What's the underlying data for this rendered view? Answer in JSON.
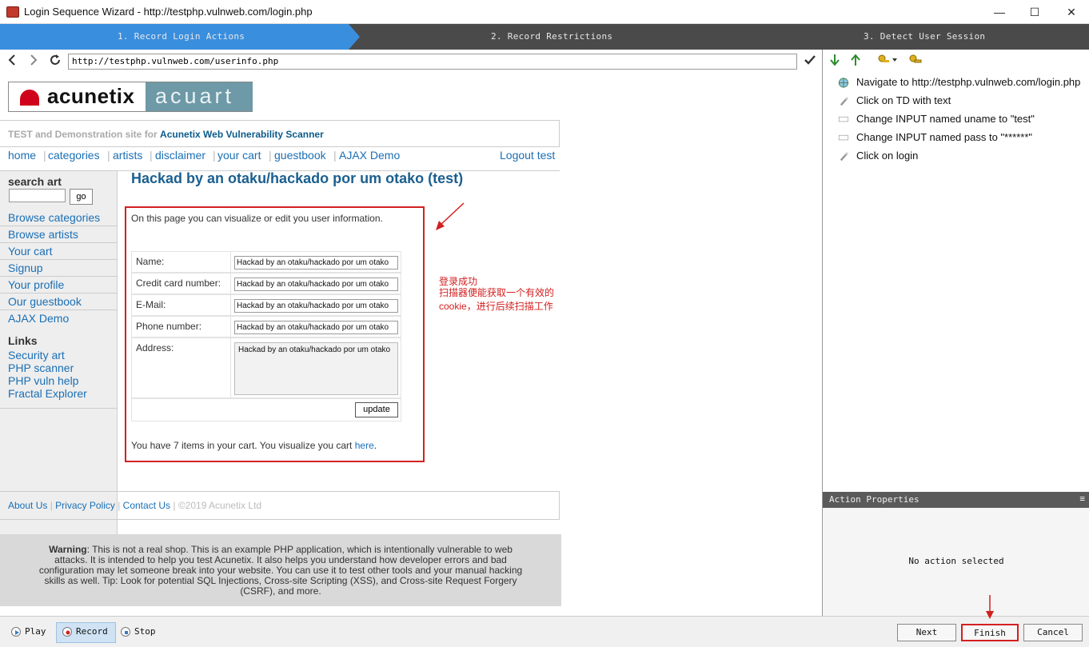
{
  "window": {
    "title": "Login Sequence Wizard - http://testphp.vulnweb.com/login.php",
    "controls": {
      "minimize": "—",
      "maximize": "☐",
      "close": "✕"
    }
  },
  "steps": [
    {
      "label": "1. Record Login Actions",
      "active": true
    },
    {
      "label": "2. Record Restrictions",
      "active": false
    },
    {
      "label": "3. Detect User Session",
      "active": false
    }
  ],
  "browser": {
    "url": "http://testphp.vulnweb.com/userinfo.php",
    "back_icon": "chevron-left-icon",
    "forward_icon": "chevron-right-icon",
    "refresh_icon": "refresh-icon",
    "go_icon": "checkmark-icon"
  },
  "site": {
    "logo_left": "acunetix",
    "logo_right": "acuart",
    "tagline_prefix": "TEST and Demonstration site for",
    "tagline_link": "Acunetix Web Vulnerability Scanner",
    "topnav": [
      "home",
      "categories",
      "artists",
      "disclaimer",
      "your cart",
      "guestbook",
      "AJAX Demo"
    ],
    "logout": "Logout test",
    "search_label": "search art",
    "search_go": "go",
    "sidebar_links": [
      "Browse categories",
      "Browse artists",
      "Your cart",
      "Signup",
      "Your profile",
      "Our guestbook",
      "AJAX Demo"
    ],
    "links_heading": "Links",
    "extra_links": [
      "Security art",
      "PHP scanner",
      "PHP vuln help",
      "Fractal Explorer"
    ],
    "page_title": "Hackad by an otaku/hackado por um otako (test)",
    "intro": "On this page you can visualize or edit you user information.",
    "form": {
      "name_label": "Name:",
      "name_value": "Hackad by an otaku/hackado por um otako",
      "cc_label": "Credit card number:",
      "cc_value": "Hackad by an otaku/hackado por um otako",
      "email_label": "E-Mail:",
      "email_value": "Hackad by an otaku/hackado por um otako",
      "phone_label": "Phone number:",
      "phone_value": "Hackad by an otaku/hackado por um otako",
      "address_label": "Address:",
      "address_value": "Hackad by an otaku/hackado por um otako",
      "update_label": "update"
    },
    "cart_text": "You have 7 items in your cart. You visualize you cart",
    "cart_link": "here",
    "cart_end": ".",
    "footer": {
      "about": "About Us",
      "privacy": "Privacy Policy",
      "contact": "Contact Us",
      "copyright": "©2019 Acunetix Ltd"
    },
    "warning_bold": "Warning",
    "warning_text": ": This is not a real shop. This is an example PHP application, which is intentionally vulnerable to web attacks. It is intended to help you test Acunetix. It also helps you understand how developer errors and bad configuration may let someone break into your website. You can use it to test other tools and your manual hacking skills as well. Tip: Look for potential SQL Injections, Cross-site Scripting (XSS), and Cross-site Request Forgery (CSRF), and more."
  },
  "annotation": {
    "line1": "登录成功",
    "line2": "扫描器便能获取一个有效的cookie，进行后续扫描工作",
    "color": "#d32020"
  },
  "actions": [
    {
      "icon": "globe-icon",
      "label": "Navigate to http://testphp.vulnweb.com/login.php"
    },
    {
      "icon": "click-icon",
      "label": "Click on TD with text"
    },
    {
      "icon": "input-icon",
      "label": "Change INPUT named uname to \"test\""
    },
    {
      "icon": "input-icon",
      "label": "Change INPUT named pass to \"******\""
    },
    {
      "icon": "click-icon",
      "label": "Click on login"
    }
  ],
  "properties": {
    "header": "Action Properties",
    "empty": "No action selected"
  },
  "bottom": {
    "play": "Play",
    "record": "Record",
    "stop": "Stop",
    "next": "Next",
    "finish": "Finish",
    "cancel": "Cancel"
  }
}
